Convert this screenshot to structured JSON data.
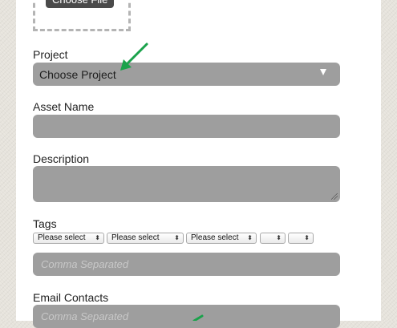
{
  "upload": {
    "choose_file_label": "Choose File"
  },
  "project": {
    "label": "Project",
    "selected": "Choose Project"
  },
  "asset_name": {
    "label": "Asset Name",
    "value": ""
  },
  "description": {
    "label": "Description",
    "value": ""
  },
  "tags": {
    "label": "Tags",
    "selects": [
      "Please select",
      "Please select",
      "Please select",
      "",
      ""
    ],
    "placeholder": "Comma Separated"
  },
  "email_contacts": {
    "label": "Email Contacts",
    "placeholder": "Comma Separated"
  },
  "colors": {
    "field_bg": "#9e9e9e",
    "annotation_arrow": "#1aa24b",
    "page_bg": "#e6e3dc"
  }
}
